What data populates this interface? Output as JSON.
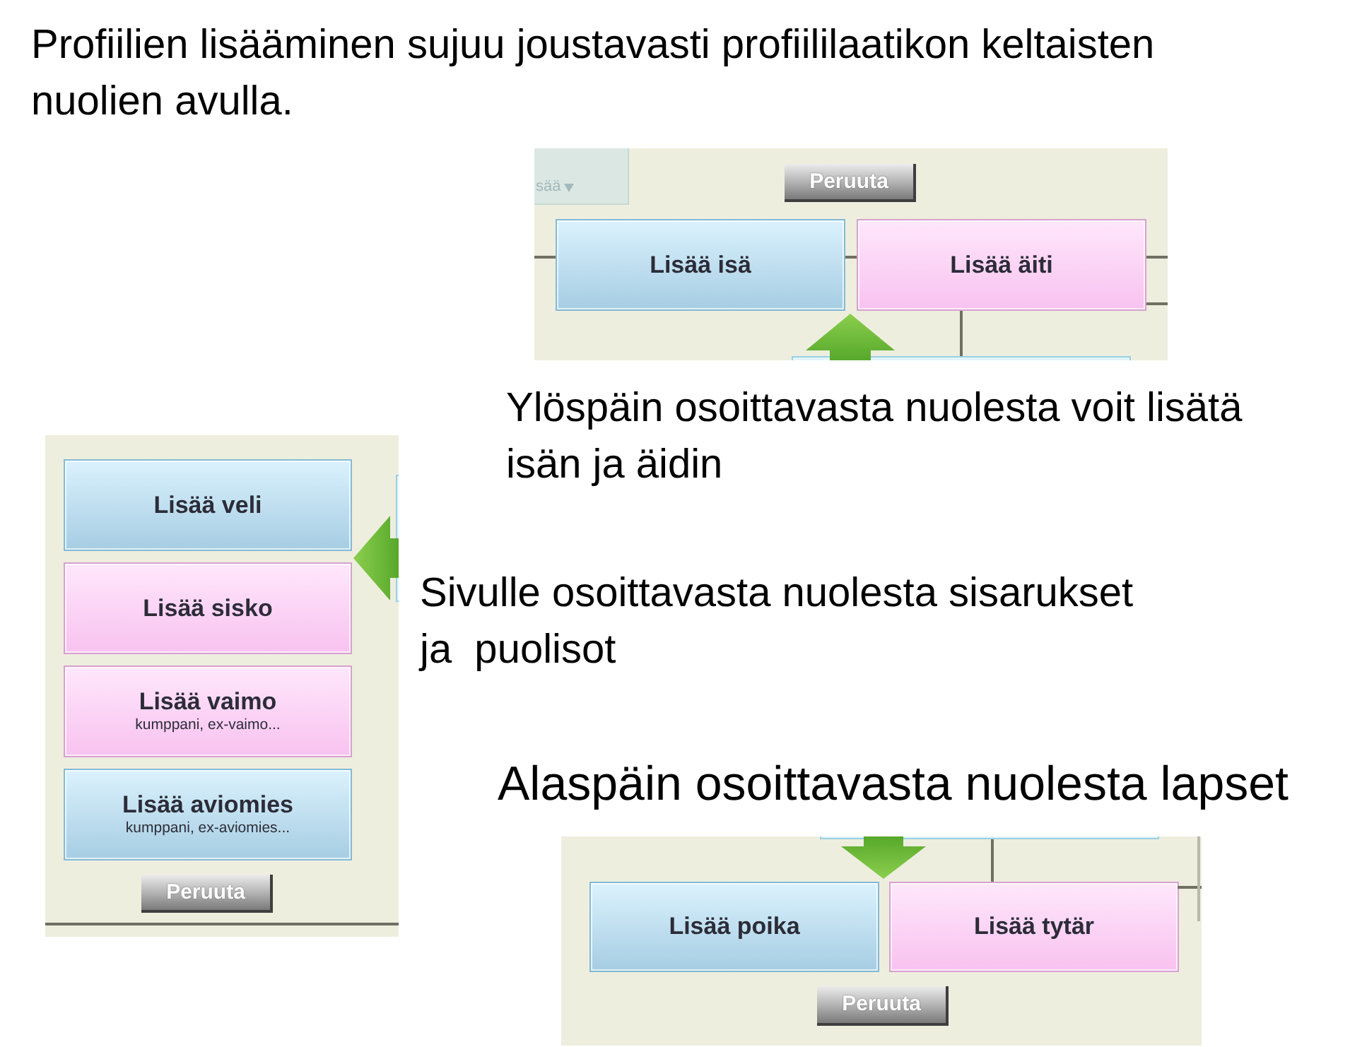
{
  "heading": "Profiilien lisääminen sujuu joustavasti profiililaatikon keltaisten nuolien avulla.",
  "parents_view": {
    "menu_fragment": "sää",
    "cancel_button": "Peruuta",
    "boxes": [
      {
        "label": "Lisää isä",
        "kind": "male"
      },
      {
        "label": "Lisää äiti",
        "kind": "female"
      }
    ]
  },
  "parents_caption": "Ylöspäin osoittavasta nuolesta voit lisätä\nisän ja äidin",
  "siblings_view": {
    "boxes": [
      {
        "label": "Lisää veli",
        "kind": "male"
      },
      {
        "label": "Lisää sisko",
        "kind": "female"
      },
      {
        "label": "Lisää vaimo",
        "sublabel": "kumppani, ex-vaimo...",
        "kind": "female"
      },
      {
        "label": "Lisää aviomies",
        "sublabel": "kumppani, ex-aviomies...",
        "kind": "male"
      }
    ],
    "cancel_button": "Peruuta"
  },
  "siblings_caption": "Sivulle osoittavasta nuolesta sisarukset\nja  puolisot",
  "children_caption": "Alaspäin osoittavasta nuolesta lapset",
  "children_view": {
    "boxes": [
      {
        "label": "Lisää poika",
        "kind": "male"
      },
      {
        "label": "Lisää tytär",
        "kind": "female"
      }
    ],
    "cancel_button": "Peruuta"
  }
}
